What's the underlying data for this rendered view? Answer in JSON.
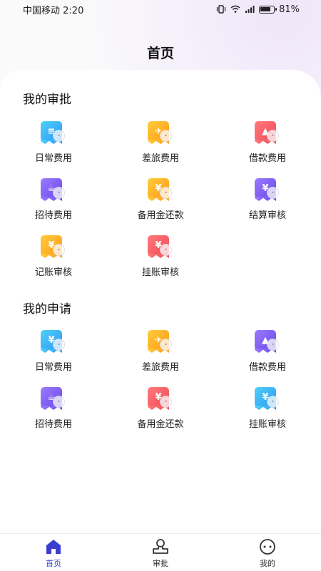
{
  "status_bar": {
    "carrier": "中国移动",
    "time": "2:20",
    "battery": "81%"
  },
  "header": {
    "title": "首页"
  },
  "approvals": {
    "title": "我的审批",
    "items": [
      {
        "label": "日常费用",
        "color": "blue",
        "glyph": "≡"
      },
      {
        "label": "差旅费用",
        "color": "orange",
        "glyph": "✈"
      },
      {
        "label": "借款费用",
        "color": "red",
        "glyph": "▲"
      },
      {
        "label": "招待费用",
        "color": "purple",
        "glyph": "☕"
      },
      {
        "label": "备用金还款",
        "color": "orange",
        "glyph": "¥"
      },
      {
        "label": "结算审核",
        "color": "purple",
        "glyph": "¥"
      },
      {
        "label": "记账审核",
        "color": "orange",
        "glyph": "¥"
      },
      {
        "label": "挂账审核",
        "color": "red",
        "glyph": "¥"
      }
    ]
  },
  "applications": {
    "title": "我的申请",
    "items": [
      {
        "label": "日常费用",
        "color": "blue",
        "glyph": "¥"
      },
      {
        "label": "差旅费用",
        "color": "orange",
        "glyph": "✈"
      },
      {
        "label": "借款费用",
        "color": "purple",
        "glyph": "▲"
      },
      {
        "label": "招待费用",
        "color": "purple",
        "glyph": "☕"
      },
      {
        "label": "备用金还款",
        "color": "red",
        "glyph": "¥"
      },
      {
        "label": "挂账审核",
        "color": "blue",
        "glyph": "¥"
      }
    ]
  },
  "tabbar": {
    "tabs": [
      {
        "label": "首页",
        "icon": "home-icon"
      },
      {
        "label": "审批",
        "icon": "approve-icon"
      },
      {
        "label": "我的",
        "icon": "profile-icon"
      }
    ],
    "accent": "#3b3fd0"
  }
}
